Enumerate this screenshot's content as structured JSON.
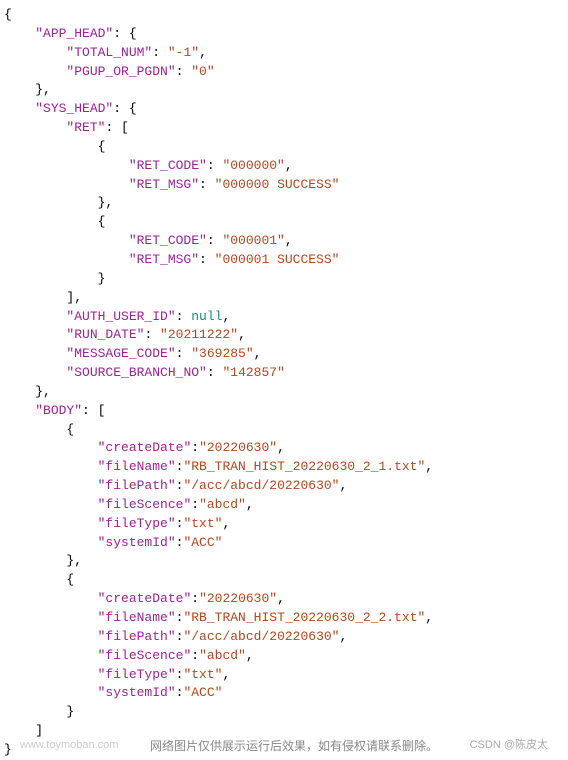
{
  "keys": {
    "appHead": "\"APP_HEAD\"",
    "totalNum": "\"TOTAL_NUM\"",
    "pgupOrPgdn": "\"PGUP_OR_PGDN\"",
    "sysHead": "\"SYS_HEAD\"",
    "ret": "\"RET\"",
    "retCode": "\"RET_CODE\"",
    "retMsg": "\"RET_MSG\"",
    "authUserId": "\"AUTH_USER_ID\"",
    "runDate": "\"RUN_DATE\"",
    "messageCode": "\"MESSAGE_CODE\"",
    "sourceBranchNo": "\"SOURCE_BRANCH_NO\"",
    "body": "\"BODY\"",
    "createDate": "\"createDate\"",
    "fileName": "\"fileName\"",
    "filePath": "\"filePath\"",
    "fileScence": "\"fileScence\"",
    "fileType": "\"fileType\"",
    "systemId": "\"systemId\""
  },
  "vals": {
    "totalNum": "\"-1\"",
    "pgupOrPgdn": "\"0\"",
    "retCode0": "\"000000\"",
    "retMsg0": "\"000000 SUCCESS\"",
    "retCode1": "\"000001\"",
    "retMsg1": "\"000001 SUCCESS\"",
    "null": "null",
    "runDate": "\"20211222\"",
    "messageCode": "\"369285\"",
    "sourceBranchNo": "\"142857\"",
    "createDate0": "\"20220630\"",
    "fileName0": "\"RB_TRAN_HIST_20220630_2_1.txt\"",
    "filePath0": "\"/acc/abcd/20220630\"",
    "fileScence0": "\"abcd\"",
    "fileType0": "\"txt\"",
    "systemId0": "\"ACC\"",
    "createDate1": "\"20220630\"",
    "fileName1": "\"RB_TRAN_HIST_20220630_2_2.txt\"",
    "filePath1": "\"/acc/abcd/20220630\"",
    "fileScence1": "\"abcd\"",
    "fileType1": "\"txt\"",
    "systemId1": "\"ACC\""
  },
  "watermark": {
    "left": "www.toymoban.com",
    "mid": "网络图片仅供展示运行后效果，如有侵权请联系删除。",
    "right": "CSDN @陈皮太"
  }
}
